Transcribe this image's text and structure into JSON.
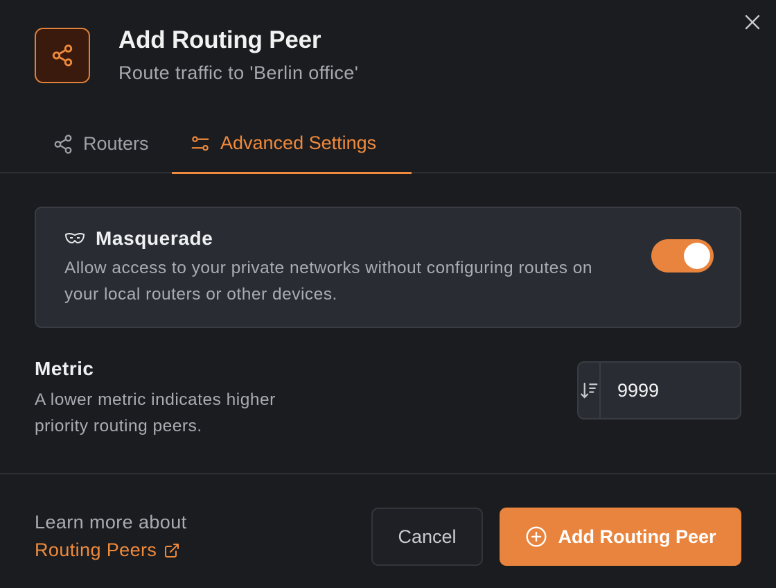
{
  "dialog": {
    "title": "Add Routing Peer",
    "subtitle": "Route traffic to 'Berlin office'",
    "header_icon": "share-icon",
    "close_icon": "close-icon"
  },
  "tabs": [
    {
      "label": "Routers",
      "icon": "share-icon",
      "active": false
    },
    {
      "label": "Advanced Settings",
      "icon": "sliders-icon",
      "active": true
    }
  ],
  "masquerade": {
    "icon": "mask-icon",
    "title": "Masquerade",
    "description": "Allow access to your private networks without configuring routes on your local routers or other devices.",
    "enabled": true
  },
  "metric": {
    "label": "Metric",
    "description": "A lower metric indicates higher priority routing peers.",
    "icon": "sort-descending-icon",
    "value": "9999"
  },
  "footer": {
    "learn_text": "Learn more about",
    "learn_link": "Routing Peers",
    "link_icon": "external-link-icon",
    "cancel_label": "Cancel",
    "submit_label": "Add Routing Peer",
    "submit_icon": "plus-circle-icon"
  },
  "colors": {
    "accent": "#e8843e",
    "background": "#1b1c20",
    "card": "#2a2c33"
  }
}
